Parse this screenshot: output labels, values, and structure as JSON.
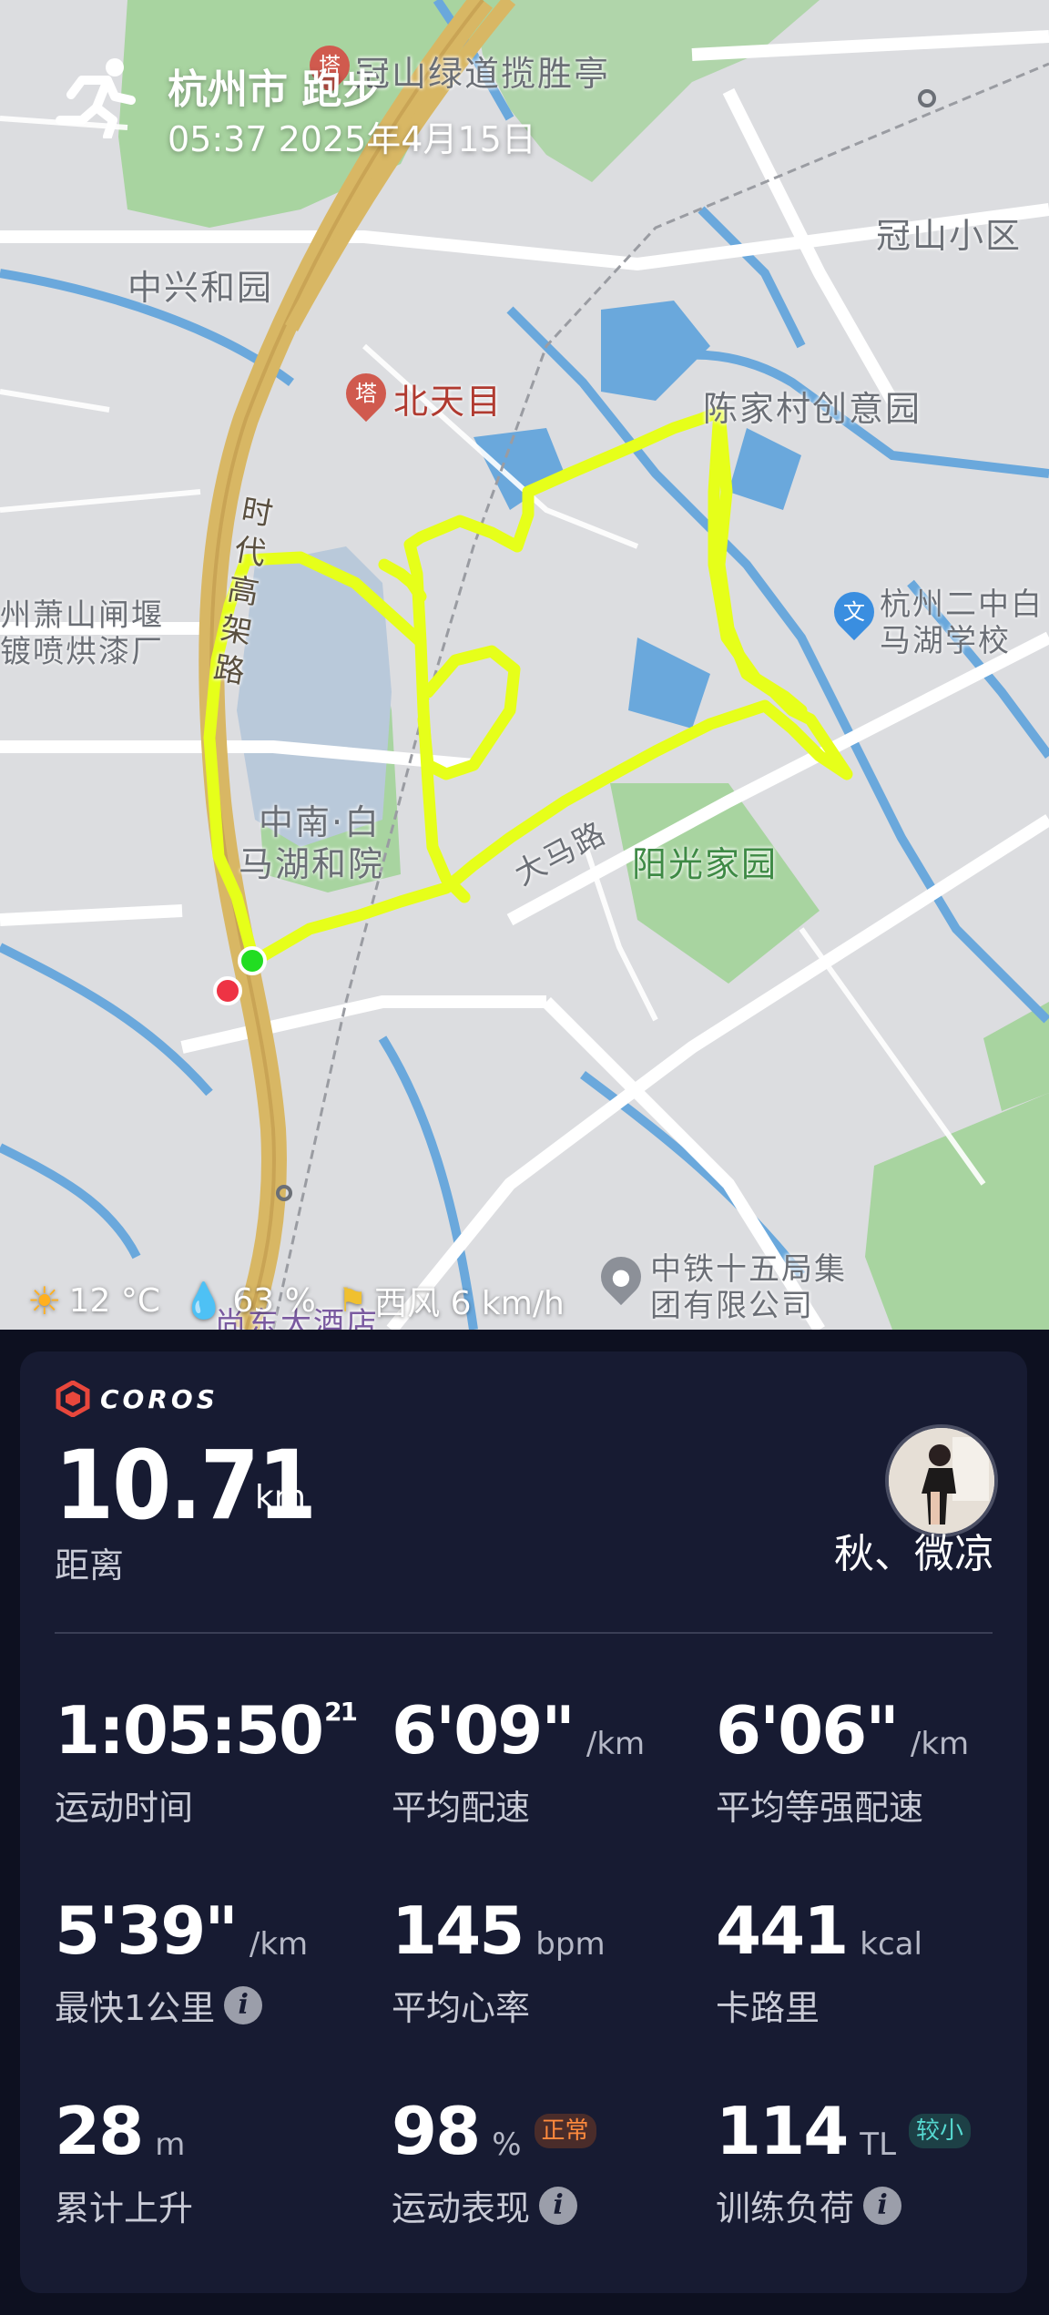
{
  "header": {
    "city_activity": "杭州市 跑步",
    "datetime": "05:37 2025年4月15日"
  },
  "map": {
    "labels": {
      "guanshan_greenway": "冠山绿道揽胜亭",
      "zhongxing": "中兴和园",
      "guanshan_district": "冠山小区",
      "beitianmu": "北天目",
      "chenjiacun": "陈家村创意园",
      "shidai_road": "时代高架路",
      "xiaoshan": "州萧山闸堰",
      "plating": "镀喷烘漆厂",
      "erzhong_1": "杭州二中白",
      "erzhong_2": "马湖学校",
      "zhongnan_1": "中南·白",
      "zhongnan_2": "马湖和院",
      "yangguang": "阳光家园",
      "road_label": "大马路",
      "crcc_1": "中铁十五局集",
      "crcc_2": "团有限公司",
      "hotel": "尚东大酒店"
    },
    "route_color": "#e6ff1a",
    "start_color": "#22dd22",
    "end_color": "#ee3344"
  },
  "weather": {
    "temperature": "12 °C",
    "humidity": "63 %",
    "wind": "西风 6 km/h"
  },
  "card": {
    "logo": "COROS",
    "distance_value": "10.71",
    "distance_unit": "km",
    "distance_label": "距离",
    "username": "秋、微凉",
    "stats": [
      {
        "value": "1:05:50",
        "sup": "21",
        "unit": "",
        "label": "运动时间"
      },
      {
        "value": "6'09\"",
        "unit": "/km",
        "label": "平均配速"
      },
      {
        "value": "6'06\"",
        "unit": "/km",
        "label": "平均等强配速"
      },
      {
        "value": "5'39\"",
        "unit": "/km",
        "label": "最快1公里",
        "info": true
      },
      {
        "value": "145",
        "unit": "bpm",
        "label": "平均心率"
      },
      {
        "value": "441",
        "unit": "kcal",
        "label": "卡路里"
      },
      {
        "value": "28",
        "unit": "m",
        "label": "累计上升"
      },
      {
        "value": "98",
        "unit": "%",
        "badge": "正常",
        "label": "运动表现",
        "info": true
      },
      {
        "value": "114",
        "unit": "TL",
        "badge": "较小",
        "label": "训练负荷",
        "info": true
      }
    ],
    "colors": {
      "card_bg": "#171b32",
      "badge_normal": "#ff8a3d",
      "badge_small": "#55d8d0"
    }
  },
  "icons": [
    "runner-icon",
    "sun-icon",
    "humidity-icon",
    "wind-icon",
    "info-icon",
    "coros-logo-icon",
    "hotel-icon",
    "pagoda-icon",
    "school-icon",
    "location-pin-icon"
  ]
}
